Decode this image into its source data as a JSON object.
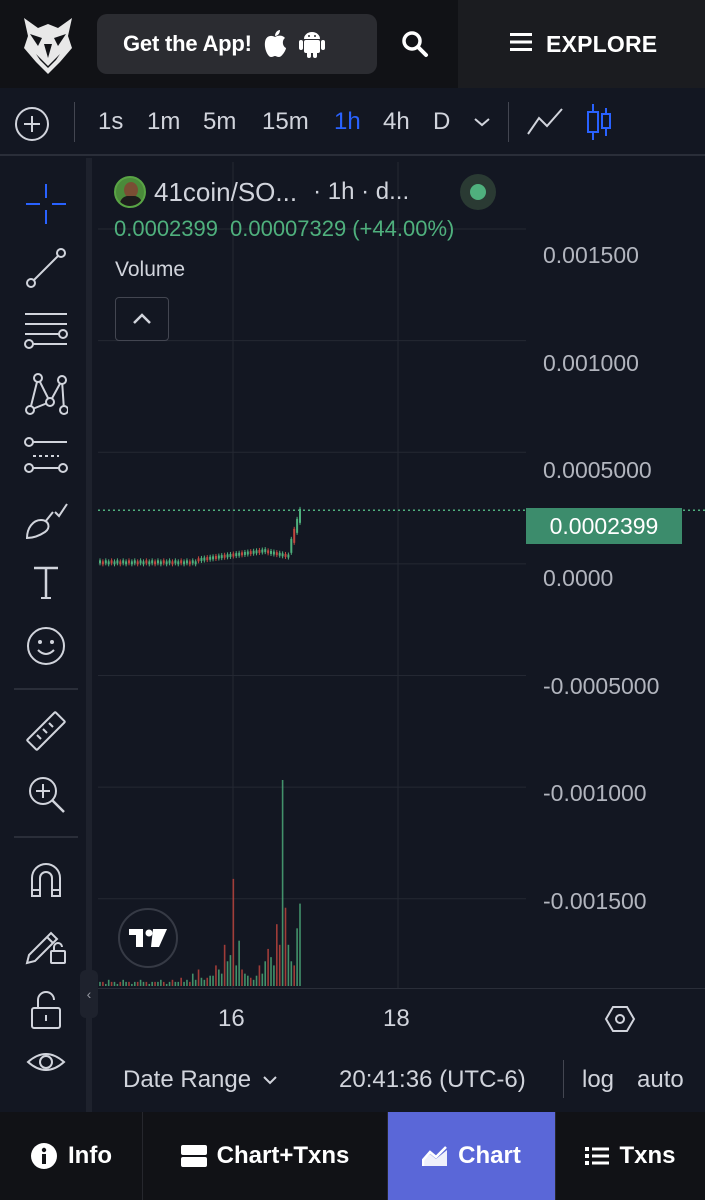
{
  "header": {
    "get_app_label": "Get the App!",
    "explore_label": "EXPLORE"
  },
  "toolbar": {
    "timeframes": [
      "1s",
      "1m",
      "5m",
      "15m",
      "1h",
      "4h",
      "D"
    ],
    "active_timeframe": "1h"
  },
  "legend": {
    "symbol": "41coin/SO...",
    "interval": "· 1h · d...",
    "last_price": "0.0002399",
    "change": "0.00007329",
    "change_pct": "(+44.00%)",
    "volume_title": "Volume"
  },
  "price_axis": {
    "labels": [
      "0.001500",
      "0.001000",
      "0.0005000",
      "0.0000",
      "-0.0005000",
      "-0.001000",
      "-0.001500"
    ],
    "last_price_label": "0.0002399"
  },
  "time_axis": {
    "labels": [
      "16",
      "18"
    ]
  },
  "bottom_controls": {
    "date_range_label": "Date Range",
    "clock": "20:41:36 (UTC-6)",
    "log_label": "log",
    "auto_label": "auto"
  },
  "bottom_nav": {
    "info_label": "Info",
    "chart_txns_label": "Chart+Txns",
    "chart_label": "Chart",
    "txns_label": "Txns"
  },
  "colors": {
    "up": "#4fb07d",
    "down": "#c4463f",
    "accent": "#2962ff",
    "nav_active": "#5a67d8"
  },
  "chart_data": {
    "type": "candlestick",
    "title": "",
    "interval": "1h",
    "ylim": [
      -0.0019,
      0.0018
    ],
    "yticks": [
      0.0015,
      0.001,
      0.0005,
      0.0,
      -0.0005,
      -0.001,
      -0.0015
    ],
    "last_price": 0.0002399,
    "x_ticks": [
      "16",
      "18"
    ],
    "volume_relative": [
      0.02,
      0.02,
      0.01,
      0.03,
      0.02,
      0.02,
      0.01,
      0.02,
      0.03,
      0.02,
      0.02,
      0.01,
      0.02,
      0.02,
      0.03,
      0.02,
      0.02,
      0.01,
      0.02,
      0.02,
      0.02,
      0.03,
      0.02,
      0.01,
      0.02,
      0.03,
      0.02,
      0.02,
      0.04,
      0.02,
      0.03,
      0.02,
      0.06,
      0.03,
      0.08,
      0.04,
      0.03,
      0.04,
      0.05,
      0.05,
      0.1,
      0.08,
      0.06,
      0.2,
      0.12,
      0.15,
      0.52,
      0.1,
      0.22,
      0.08,
      0.06,
      0.05,
      0.04,
      0.03,
      0.05,
      0.1,
      0.06,
      0.12,
      0.18,
      0.14,
      0.1,
      0.3,
      0.2,
      1.0,
      0.38,
      0.2,
      0.12,
      0.1,
      0.28,
      0.4
    ]
  }
}
